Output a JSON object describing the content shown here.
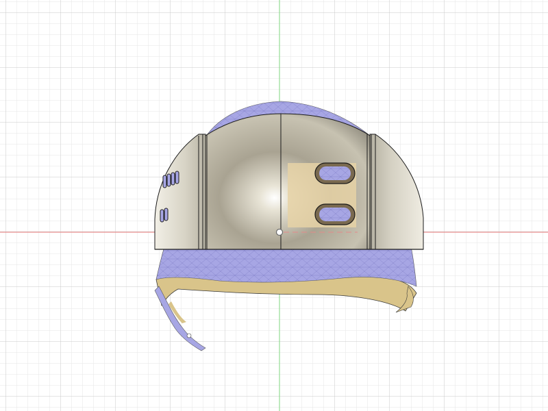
{
  "viewport": {
    "background": "#ffffff",
    "grid_minor_color": "#e6e6e6",
    "grid_major_color": "#c9c9c9",
    "axis_x_color": "#f08080",
    "axis_y_color": "#7fd67f"
  },
  "model": {
    "shell_color": "#c9c4b2",
    "mesh_color": "#a7a6e4",
    "mesh_line_color": "#6d6cb8",
    "inner_color": "#d9c48a",
    "edge_color": "#1a1a1a"
  },
  "icons": {
    "origin": "origin-point-icon"
  }
}
